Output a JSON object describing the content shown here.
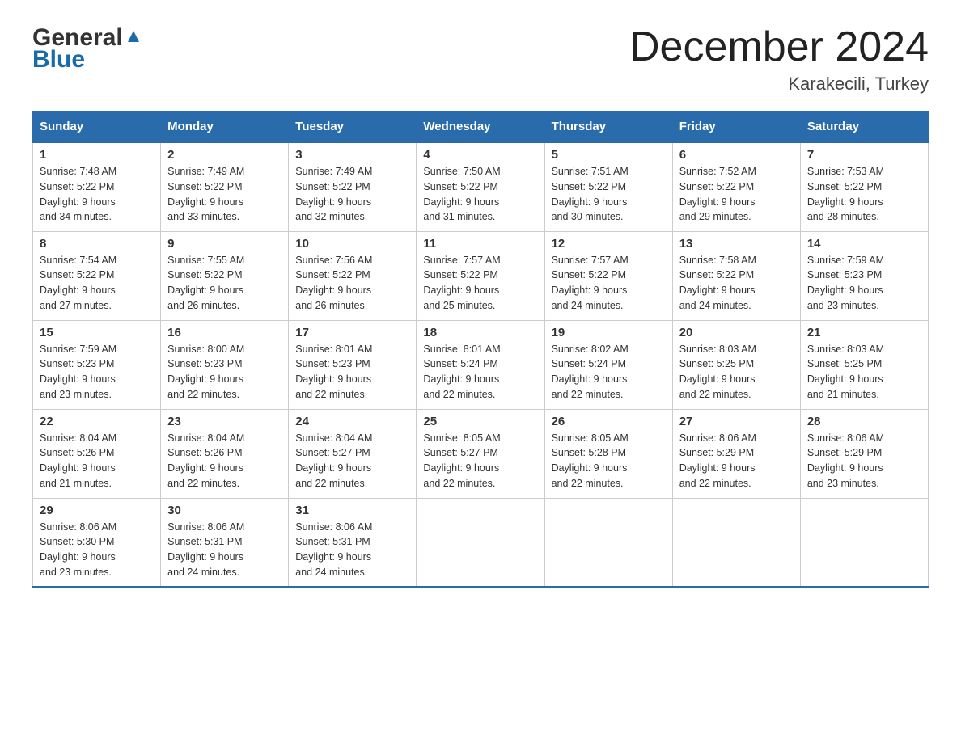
{
  "header": {
    "logo_general": "General",
    "logo_blue": "Blue",
    "month_title": "December 2024",
    "location": "Karakecili, Turkey"
  },
  "days_of_week": [
    "Sunday",
    "Monday",
    "Tuesday",
    "Wednesday",
    "Thursday",
    "Friday",
    "Saturday"
  ],
  "weeks": [
    [
      {
        "day": "1",
        "sunrise": "7:48 AM",
        "sunset": "5:22 PM",
        "daylight": "9 hours and 34 minutes."
      },
      {
        "day": "2",
        "sunrise": "7:49 AM",
        "sunset": "5:22 PM",
        "daylight": "9 hours and 33 minutes."
      },
      {
        "day": "3",
        "sunrise": "7:49 AM",
        "sunset": "5:22 PM",
        "daylight": "9 hours and 32 minutes."
      },
      {
        "day": "4",
        "sunrise": "7:50 AM",
        "sunset": "5:22 PM",
        "daylight": "9 hours and 31 minutes."
      },
      {
        "day": "5",
        "sunrise": "7:51 AM",
        "sunset": "5:22 PM",
        "daylight": "9 hours and 30 minutes."
      },
      {
        "day": "6",
        "sunrise": "7:52 AM",
        "sunset": "5:22 PM",
        "daylight": "9 hours and 29 minutes."
      },
      {
        "day": "7",
        "sunrise": "7:53 AM",
        "sunset": "5:22 PM",
        "daylight": "9 hours and 28 minutes."
      }
    ],
    [
      {
        "day": "8",
        "sunrise": "7:54 AM",
        "sunset": "5:22 PM",
        "daylight": "9 hours and 27 minutes."
      },
      {
        "day": "9",
        "sunrise": "7:55 AM",
        "sunset": "5:22 PM",
        "daylight": "9 hours and 26 minutes."
      },
      {
        "day": "10",
        "sunrise": "7:56 AM",
        "sunset": "5:22 PM",
        "daylight": "9 hours and 26 minutes."
      },
      {
        "day": "11",
        "sunrise": "7:57 AM",
        "sunset": "5:22 PM",
        "daylight": "9 hours and 25 minutes."
      },
      {
        "day": "12",
        "sunrise": "7:57 AM",
        "sunset": "5:22 PM",
        "daylight": "9 hours and 24 minutes."
      },
      {
        "day": "13",
        "sunrise": "7:58 AM",
        "sunset": "5:22 PM",
        "daylight": "9 hours and 24 minutes."
      },
      {
        "day": "14",
        "sunrise": "7:59 AM",
        "sunset": "5:23 PM",
        "daylight": "9 hours and 23 minutes."
      }
    ],
    [
      {
        "day": "15",
        "sunrise": "7:59 AM",
        "sunset": "5:23 PM",
        "daylight": "9 hours and 23 minutes."
      },
      {
        "day": "16",
        "sunrise": "8:00 AM",
        "sunset": "5:23 PM",
        "daylight": "9 hours and 22 minutes."
      },
      {
        "day": "17",
        "sunrise": "8:01 AM",
        "sunset": "5:23 PM",
        "daylight": "9 hours and 22 minutes."
      },
      {
        "day": "18",
        "sunrise": "8:01 AM",
        "sunset": "5:24 PM",
        "daylight": "9 hours and 22 minutes."
      },
      {
        "day": "19",
        "sunrise": "8:02 AM",
        "sunset": "5:24 PM",
        "daylight": "9 hours and 22 minutes."
      },
      {
        "day": "20",
        "sunrise": "8:03 AM",
        "sunset": "5:25 PM",
        "daylight": "9 hours and 22 minutes."
      },
      {
        "day": "21",
        "sunrise": "8:03 AM",
        "sunset": "5:25 PM",
        "daylight": "9 hours and 21 minutes."
      }
    ],
    [
      {
        "day": "22",
        "sunrise": "8:04 AM",
        "sunset": "5:26 PM",
        "daylight": "9 hours and 21 minutes."
      },
      {
        "day": "23",
        "sunrise": "8:04 AM",
        "sunset": "5:26 PM",
        "daylight": "9 hours and 22 minutes."
      },
      {
        "day": "24",
        "sunrise": "8:04 AM",
        "sunset": "5:27 PM",
        "daylight": "9 hours and 22 minutes."
      },
      {
        "day": "25",
        "sunrise": "8:05 AM",
        "sunset": "5:27 PM",
        "daylight": "9 hours and 22 minutes."
      },
      {
        "day": "26",
        "sunrise": "8:05 AM",
        "sunset": "5:28 PM",
        "daylight": "9 hours and 22 minutes."
      },
      {
        "day": "27",
        "sunrise": "8:06 AM",
        "sunset": "5:29 PM",
        "daylight": "9 hours and 22 minutes."
      },
      {
        "day": "28",
        "sunrise": "8:06 AM",
        "sunset": "5:29 PM",
        "daylight": "9 hours and 23 minutes."
      }
    ],
    [
      {
        "day": "29",
        "sunrise": "8:06 AM",
        "sunset": "5:30 PM",
        "daylight": "9 hours and 23 minutes."
      },
      {
        "day": "30",
        "sunrise": "8:06 AM",
        "sunset": "5:31 PM",
        "daylight": "9 hours and 24 minutes."
      },
      {
        "day": "31",
        "sunrise": "8:06 AM",
        "sunset": "5:31 PM",
        "daylight": "9 hours and 24 minutes."
      },
      null,
      null,
      null,
      null
    ]
  ],
  "labels": {
    "sunrise": "Sunrise:",
    "sunset": "Sunset:",
    "daylight": "Daylight:"
  }
}
